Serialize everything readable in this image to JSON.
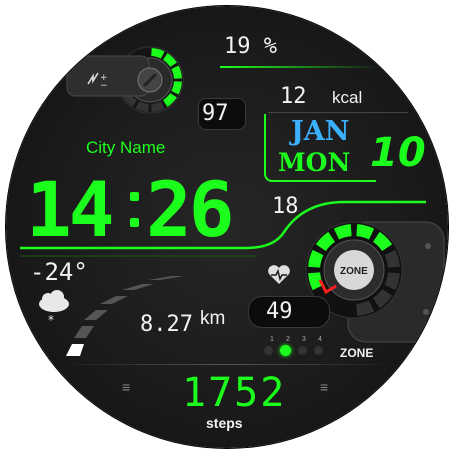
{
  "colors": {
    "accent": "#1cff1c",
    "month_blue": "#3ab0ff",
    "marker_red": "#ff2020"
  },
  "battery": {
    "percent_label": "19 %",
    "level": 0.6
  },
  "calories": {
    "value": "12",
    "unit": "kcal"
  },
  "battery_value": "97",
  "city": "City Name",
  "date": {
    "month": "JAN",
    "weekday": "MON",
    "day": "10"
  },
  "time": {
    "hours": "14",
    "minutes": "26",
    "seconds": "18"
  },
  "weather": {
    "temperature": "-24°",
    "icon": "cloud-snow-icon"
  },
  "distance": {
    "value": "8.27",
    "unit": "km"
  },
  "heart": {
    "value": "49",
    "icon": "heart-rate-icon"
  },
  "zone": {
    "label": "ZONE",
    "levels": [
      "1",
      "2",
      "3",
      "4"
    ],
    "active": 2
  },
  "steps": {
    "value": "1752",
    "label": "steps"
  }
}
